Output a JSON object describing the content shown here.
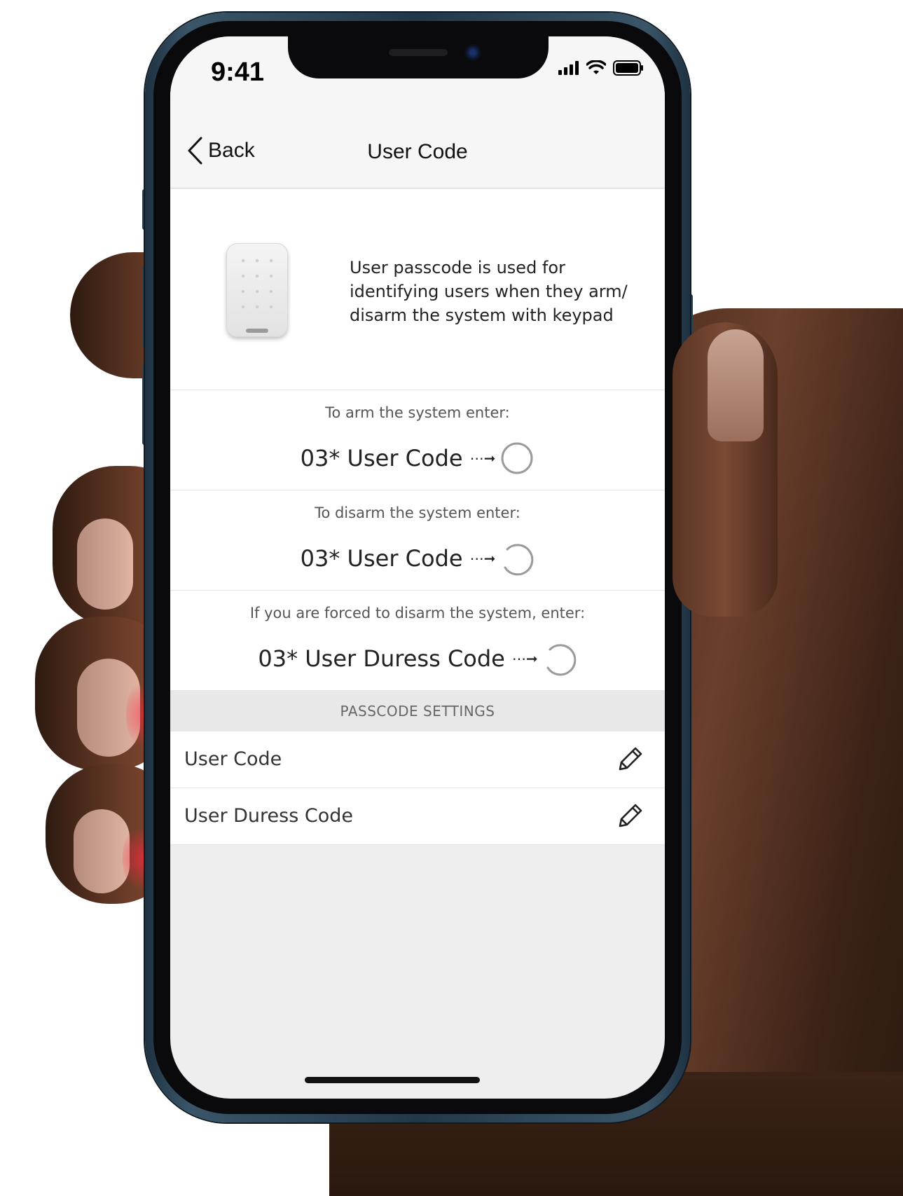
{
  "status_bar": {
    "time": "9:41"
  },
  "nav": {
    "back_label": "Back",
    "title": "User Code"
  },
  "intro": {
    "description": "User passcode is used for identifying users when they arm/ disarm the system with keypad"
  },
  "instructions": [
    {
      "label": "To arm the system enter:",
      "code": "03* User Code",
      "icon": "arm-circle-icon"
    },
    {
      "label": "To disarm the system enter:",
      "code": "03* User Code",
      "icon": "disarm-circle-icon"
    },
    {
      "label": "If you are forced to disarm the system, enter:",
      "code": "03* User Duress Code",
      "icon": "duress-circle-icon"
    }
  ],
  "passcode_settings": {
    "header": "PASSCODE SETTINGS",
    "items": [
      {
        "label": "User Code",
        "icon": "pencil-icon"
      },
      {
        "label": "User Duress Code",
        "icon": "pencil-icon"
      }
    ]
  },
  "colors": {
    "screen_background": "#eeeeee",
    "content_background": "#ffffff",
    "section_header_background": "#e8e8e8"
  }
}
